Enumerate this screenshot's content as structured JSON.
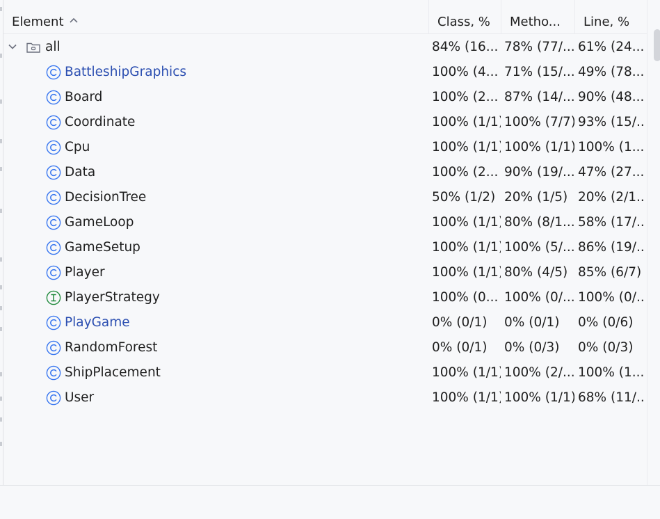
{
  "header": {
    "element": "Element",
    "class": "Class, %",
    "method": "Metho...",
    "line": "Line, %"
  },
  "root": {
    "name": "all",
    "class": "84% (16...",
    "method": "78% (77/...",
    "line": "61% (24..."
  },
  "rows": [
    {
      "name": "BattleshipGraphics",
      "kind": "class",
      "highlight": true,
      "class": "100% (4...",
      "method": "71% (15/...",
      "line": "49% (78..."
    },
    {
      "name": "Board",
      "kind": "class",
      "highlight": false,
      "class": "100% (2...",
      "method": "87% (14/...",
      "line": "90% (48..."
    },
    {
      "name": "Coordinate",
      "kind": "class",
      "highlight": false,
      "class": "100% (1/1)",
      "method": "100% (7/7)",
      "line": "93% (15/..."
    },
    {
      "name": "Cpu",
      "kind": "class",
      "highlight": false,
      "class": "100% (1/1)",
      "method": "100% (1/1)",
      "line": "100% (1..."
    },
    {
      "name": "Data",
      "kind": "class",
      "highlight": false,
      "class": "100% (2...",
      "method": "90% (19/...",
      "line": "47% (27..."
    },
    {
      "name": "DecisionTree",
      "kind": "class",
      "highlight": false,
      "class": "50% (1/2)",
      "method": "20% (1/5)",
      "line": "20% (2/1..."
    },
    {
      "name": "GameLoop",
      "kind": "class",
      "highlight": false,
      "class": "100% (1/1)",
      "method": "80% (8/1...",
      "line": "58% (17/..."
    },
    {
      "name": "GameSetup",
      "kind": "class",
      "highlight": false,
      "class": "100% (1/1)",
      "method": "100% (5/...",
      "line": "86% (19/..."
    },
    {
      "name": "Player",
      "kind": "class",
      "highlight": false,
      "class": "100% (1/1)",
      "method": "80% (4/5)",
      "line": "85% (6/7)"
    },
    {
      "name": "PlayerStrategy",
      "kind": "interface",
      "highlight": false,
      "class": "100% (0...",
      "method": "100% (0/...",
      "line": "100% (0/..."
    },
    {
      "name": "PlayGame",
      "kind": "class",
      "highlight": true,
      "class": "0% (0/1)",
      "method": "0% (0/1)",
      "line": "0% (0/6)"
    },
    {
      "name": "RandomForest",
      "kind": "class",
      "highlight": false,
      "class": "0% (0/1)",
      "method": "0% (0/3)",
      "line": "0% (0/3)"
    },
    {
      "name": "ShipPlacement",
      "kind": "class",
      "highlight": false,
      "class": "100% (1/1)",
      "method": "100% (2/...",
      "line": "100% (1..."
    },
    {
      "name": "User",
      "kind": "class",
      "highlight": false,
      "class": "100% (1/1)",
      "method": "100% (1/1)",
      "line": "68% (11/..."
    }
  ],
  "icons": {
    "class": "class-icon",
    "interface": "interface-icon",
    "root": "folder-icon",
    "expand": "chevron-down-icon",
    "sort": "sort-ascending-icon"
  },
  "colors": {
    "class_icon": "#3574f0",
    "interface_icon": "#208a3c",
    "link_text": "#2c4fb1"
  }
}
